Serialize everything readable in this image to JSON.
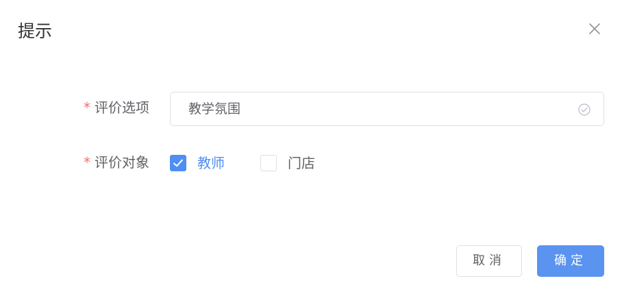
{
  "dialog": {
    "title": "提示",
    "close_icon": "close-icon"
  },
  "form": {
    "option": {
      "required_mark": "*",
      "label": "评价选项",
      "value": "教学氛围",
      "suffix_icon": "circle-check-icon"
    },
    "target": {
      "required_mark": "*",
      "label": "评价对象",
      "options": [
        {
          "label": "教师",
          "checked": true
        },
        {
          "label": "门店",
          "checked": false
        }
      ]
    }
  },
  "footer": {
    "cancel_label": "取消",
    "confirm_label": "确定"
  },
  "colors": {
    "primary": "#4f8ef2",
    "required": "#f56c6c",
    "border": "#dcdfe6"
  }
}
